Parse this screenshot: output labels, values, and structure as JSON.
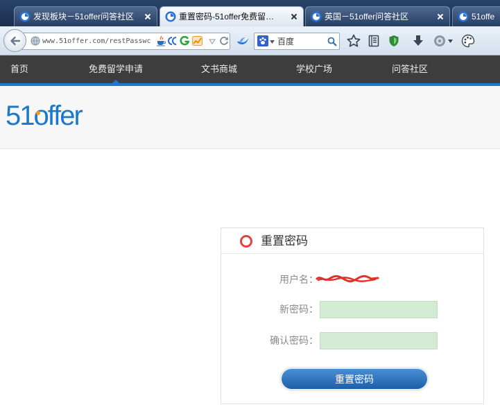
{
  "browser": {
    "tabs": [
      {
        "title": "发现板块－51offer问答社区"
      },
      {
        "title": "重置密码-51offer免费留…"
      },
      {
        "title": "英国－51offer问答社区"
      },
      {
        "title": "51offe"
      }
    ],
    "active_tab": 1,
    "address_bar": {
      "url": "www.51offer.com/restPasswc"
    },
    "search_bar": {
      "engine": "百度"
    }
  },
  "site": {
    "logo": "51offer",
    "nav": [
      {
        "label": "首页"
      },
      {
        "label": "免费留学申请"
      },
      {
        "label": "文书商城"
      },
      {
        "label": "学校广场"
      },
      {
        "label": "问答社区"
      }
    ],
    "active_nav": 1
  },
  "reset_password": {
    "title": "重置密码",
    "fields": {
      "username": {
        "label": "用户名："
      },
      "new_password": {
        "label": "新密码："
      },
      "confirm_password": {
        "label": "确认密码："
      }
    },
    "submit_label": "重置密码"
  },
  "icons": {
    "tabs": [
      "site-favicon-icon",
      "close-icon"
    ],
    "toolbar": [
      "back-arrow-icon",
      "globe-icon",
      "java-icon",
      "double-arc-icon",
      "g-letter-icon",
      "chart-icon",
      "dropdown-icon",
      "reload-icon",
      "bird-icon",
      "paw-icon",
      "search-icon",
      "star-icon",
      "reader-list-icon",
      "shield-icon",
      "download-arrow-icon",
      "gray-globe-icon",
      "palette-icon"
    ],
    "panel": [
      "circle-icon"
    ]
  },
  "colors": {
    "tabstrip_background": "#1b2e4c",
    "nav_background": "#3d3d3d",
    "nav_accent": "#1e78d2",
    "brand_blue": "#1b78cb",
    "logo_orange": "#f39a1e",
    "title_icon_red": "#e8413c",
    "input_background": "#d3ead3",
    "button_blue": "#2b6db8",
    "redaction_red": "#e0302a"
  }
}
